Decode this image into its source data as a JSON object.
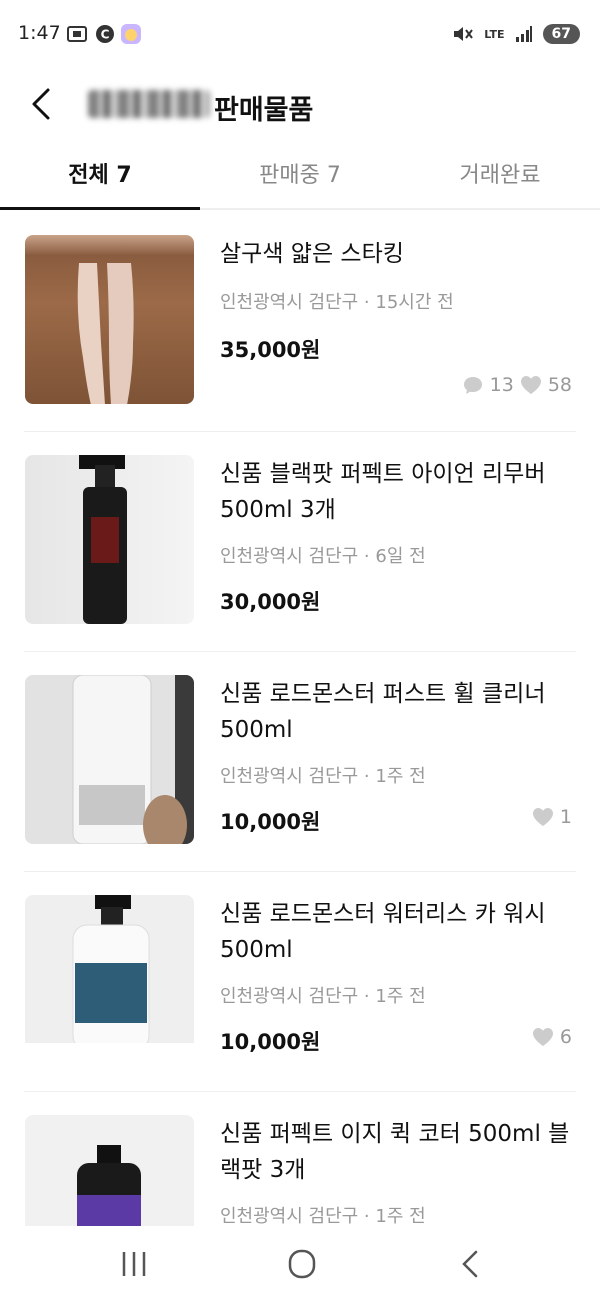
{
  "status": {
    "time": "1:47",
    "network": "LTE",
    "battery": "67"
  },
  "header": {
    "title": "판매물품",
    "back_icon": "chevron-left-icon"
  },
  "tabs": [
    {
      "label": "전체 7",
      "active": true
    },
    {
      "label": "판매중 7",
      "active": false
    },
    {
      "label": "거래완료",
      "active": false
    }
  ],
  "items": [
    {
      "title": "살구색 얇은 스타킹",
      "location": "인천광역시 검단구 · 15시간 전",
      "price": "35,000원",
      "chats": "13",
      "likes": "58"
    },
    {
      "title": "신품 블랙팟 퍼펙트 아이언 리무버 500ml 3개",
      "location": "인천광역시 검단구 · 6일 전",
      "price": "30,000원"
    },
    {
      "title": "신품 로드몬스터 퍼스트 휠 클리너 500ml",
      "location": "인천광역시 검단구 · 1주 전",
      "price": "10,000원",
      "likes": "1"
    },
    {
      "title": "신품 로드몬스터 워터리스 카 워시 500ml",
      "location": "인천광역시 검단구 · 1주 전",
      "price": "10,000원",
      "likes": "6"
    },
    {
      "title": "신품 퍼펙트 이지 퀵 코터 500ml 블랙팟 3개",
      "location": "인천광역시 검단구 · 1주 전",
      "price": ""
    }
  ],
  "nav": {
    "recent": "recent-apps-icon",
    "home": "home-icon",
    "back": "back-icon"
  }
}
